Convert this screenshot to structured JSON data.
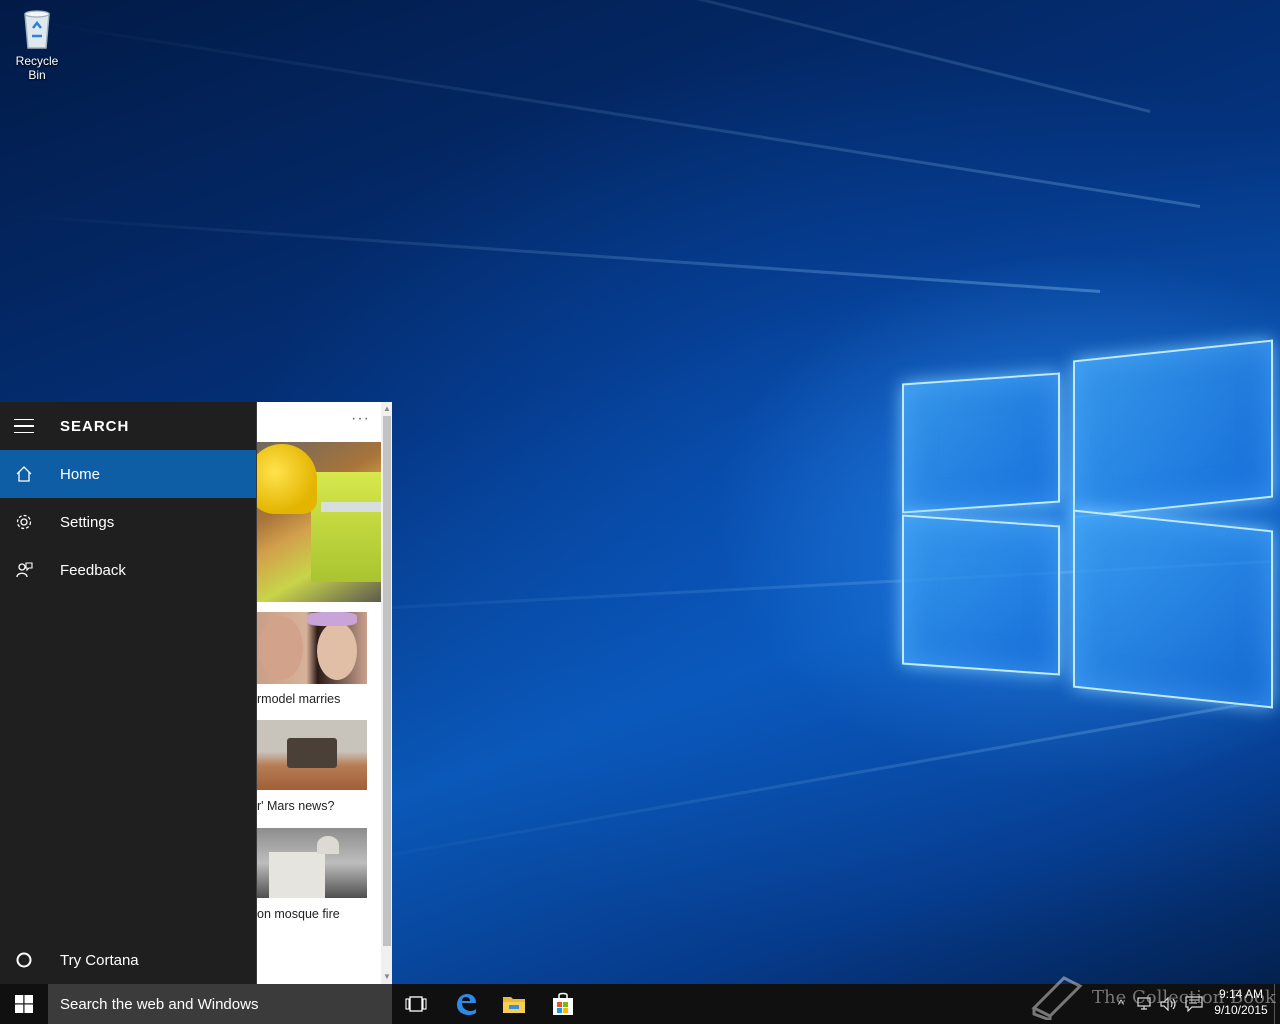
{
  "desktop": {
    "recycle_bin_label": "Recycle Bin"
  },
  "search_panel": {
    "title": "SEARCH",
    "nav_items": [
      {
        "label": "Home",
        "icon": "home-icon",
        "active": true
      },
      {
        "label": "Settings",
        "icon": "gear-icon",
        "active": false
      },
      {
        "label": "Feedback",
        "icon": "feedback-icon",
        "active": false
      }
    ],
    "try_cortana_label": "Try Cortana",
    "accent_color": "#0e5ea6"
  },
  "news_feed": {
    "more_label": "···",
    "captions": [
      "rmodel marries",
      "r' Mars news?",
      "on mosque fire"
    ]
  },
  "taskbar": {
    "search_placeholder": "Search the web and Windows",
    "pinned_icons": [
      "task-view-icon",
      "edge-icon",
      "file-explorer-icon",
      "store-icon"
    ],
    "clock_time": "9:14 AM",
    "clock_date": "9/10/2015"
  },
  "watermark": {
    "text": "The Collection Book"
  }
}
